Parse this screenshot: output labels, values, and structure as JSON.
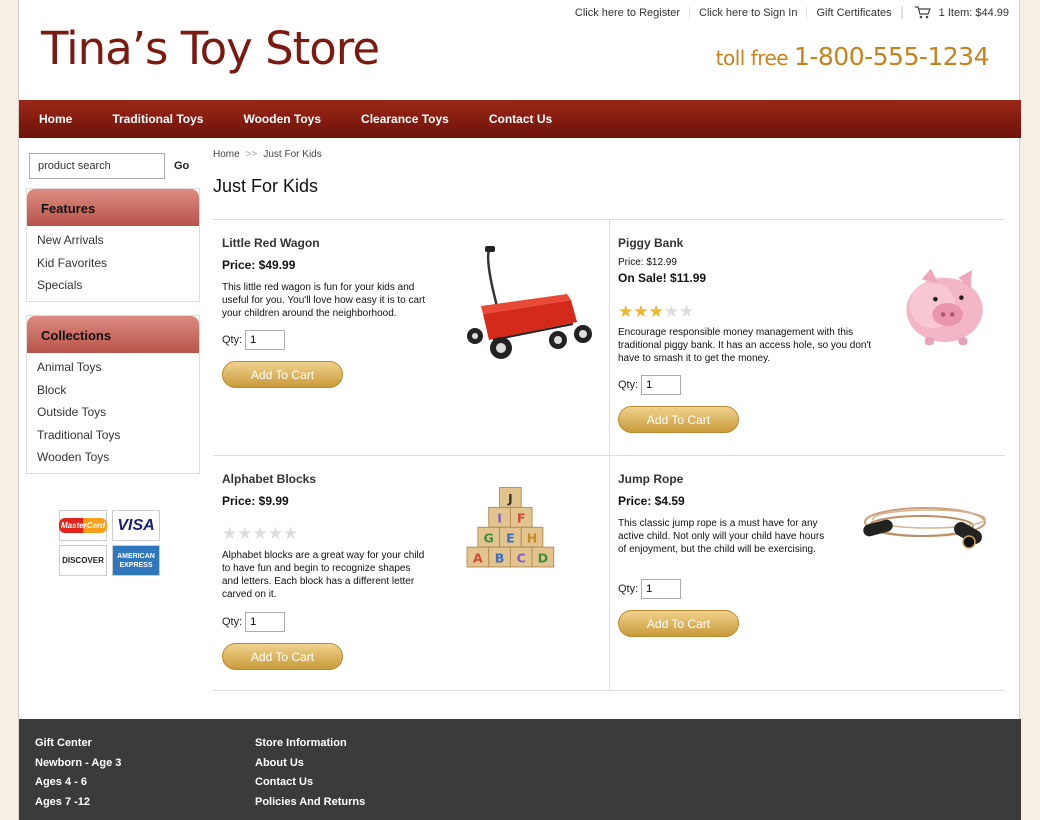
{
  "header": {
    "links": [
      "Click here to Register",
      "Click here to Sign In",
      "Gift Certificates"
    ],
    "cart_text": "1 Item: $44.99",
    "logo": "Tina’s Toy Store",
    "phone_prefix": "toll free ",
    "phone_number": "1-800-555-1234"
  },
  "nav": [
    "Home",
    "Traditional Toys",
    "Wooden Toys",
    "Clearance Toys",
    "Contact Us"
  ],
  "sidebar": {
    "search_placeholder": "product search",
    "go_label": "Go",
    "features": {
      "title": "Features",
      "items": [
        "New Arrivals",
        "Kid Favorites",
        "Specials"
      ]
    },
    "collections": {
      "title": "Collections",
      "items": [
        "Animal Toys",
        "Block",
        "Outside Toys",
        "Traditional Toys",
        "Wooden Toys"
      ]
    },
    "cards": [
      "MasterCard",
      "VISA",
      "DISCOVER",
      "AMERICAN EXPRESS"
    ]
  },
  "breadcrumb": [
    "Home",
    "Just For Kids"
  ],
  "page_title": "Just For Kids",
  "products": [
    {
      "name": "Little Red Wagon",
      "price": "Price: $49.99",
      "desc": "This little red wagon is fun for your kids and useful for you. You'll love how easy it is to cart your children around the neighborhood.",
      "qty_label": "Qty:",
      "qty": "1",
      "button": "Add To Cart"
    },
    {
      "name": "Piggy Bank",
      "old_price": "Price: $12.99",
      "price": "On Sale! $11.99",
      "rating": 3,
      "desc": "Encourage responsible money management with this traditional piggy bank. It has an access hole, so you don't have to smash it to get the money.",
      "qty_label": "Qty:",
      "qty": "1",
      "button": "Add To Cart"
    },
    {
      "name": "Alphabet Blocks",
      "price": "Price: $9.99",
      "rating": 0,
      "desc": "Alphabet blocks are a great way for your child to have fun and begin to recognize shapes and letters. Each block has a different letter carved on it.",
      "qty_label": "Qty:",
      "qty": "1",
      "button": "Add To Cart"
    },
    {
      "name": "Jump Rope",
      "price": "Price: $4.59",
      "desc": "This classic jump rope is a must have for any active child. Not only will your child have hours of enjoyment, but the child will be exercising.",
      "qty_label": "Qty:",
      "qty": "1",
      "button": "Add To Cart"
    }
  ],
  "blocks_letters": [
    "J",
    "I",
    "F",
    "G",
    "E",
    "H",
    "A",
    "B",
    "C",
    "D"
  ],
  "footer": {
    "col1": [
      "Gift Center",
      "Newborn - Age 3",
      "Ages 4 - 6",
      "Ages 7 -12"
    ],
    "col2": [
      "Store Information",
      "About Us",
      "Contact Us",
      "Policies And Returns"
    ]
  },
  "colors": {
    "brand": "#7a1a10",
    "phone": "#c8821a",
    "nav": "#8a1f12",
    "footer": "#3b3b3b",
    "button": "#d9ae5a"
  }
}
